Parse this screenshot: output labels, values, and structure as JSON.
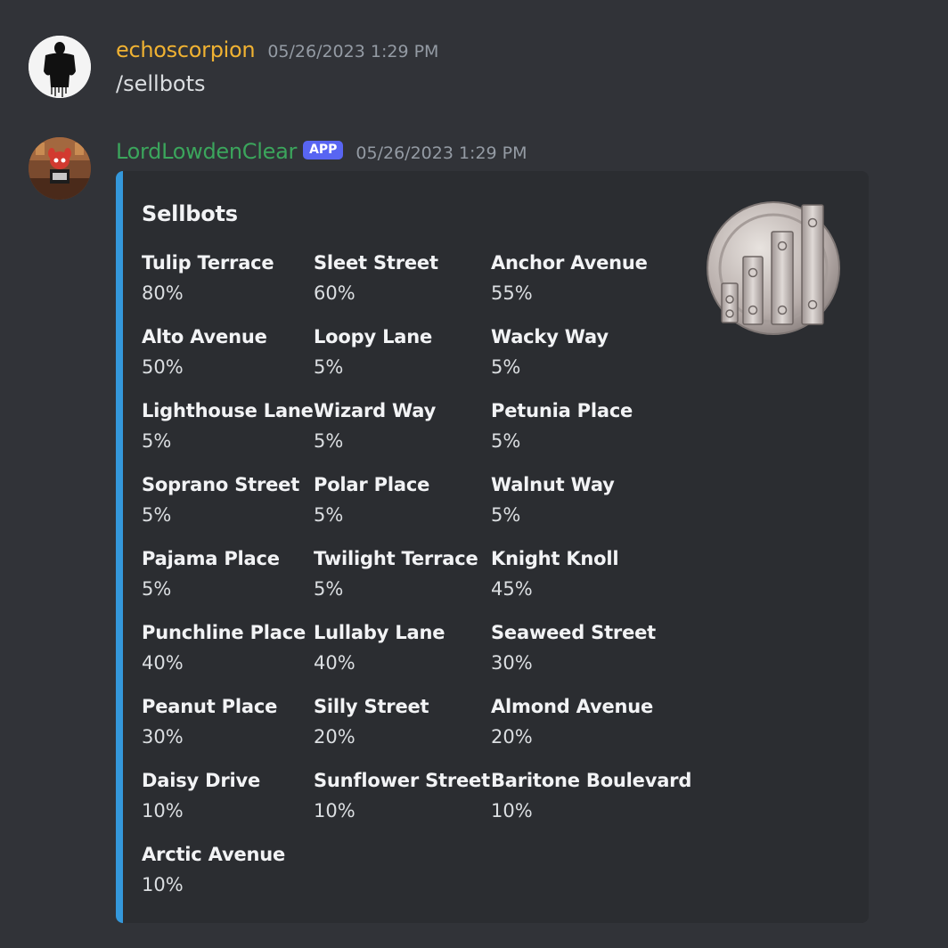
{
  "messages": [
    {
      "username": "echoscorpion",
      "username_color": "#f0b232",
      "timestamp": "05/26/2023 1:29 PM",
      "content": "/sellbots",
      "avatar_icon": "silhouette-avatar"
    },
    {
      "username": "LordLowdenClear",
      "username_color": "#3ba55c",
      "badge": "APP",
      "timestamp": "05/26/2023 1:29 PM",
      "avatar_icon": "toon-avatar"
    }
  ],
  "embed": {
    "accent_color": "#3498db",
    "title": "Sellbots",
    "thumbnail_icon": "sellbot-emblem",
    "fields": [
      {
        "name": "Tulip Terrace",
        "value": "80%"
      },
      {
        "name": "Sleet Street",
        "value": "60%"
      },
      {
        "name": "Anchor Avenue",
        "value": "55%"
      },
      {
        "name": "Alto Avenue",
        "value": "50%"
      },
      {
        "name": "Loopy Lane",
        "value": "5%"
      },
      {
        "name": "Wacky Way",
        "value": "5%"
      },
      {
        "name": "Lighthouse Lane",
        "value": "5%"
      },
      {
        "name": "Wizard Way",
        "value": "5%"
      },
      {
        "name": "Petunia Place",
        "value": "5%"
      },
      {
        "name": "Soprano Street",
        "value": "5%"
      },
      {
        "name": "Polar Place",
        "value": "5%"
      },
      {
        "name": "Walnut Way",
        "value": "5%"
      },
      {
        "name": "Pajama Place",
        "value": "5%"
      },
      {
        "name": "Twilight Terrace",
        "value": "5%"
      },
      {
        "name": "Knight Knoll",
        "value": "45%"
      },
      {
        "name": "Punchline Place",
        "value": "40%"
      },
      {
        "name": "Lullaby Lane",
        "value": "40%"
      },
      {
        "name": "Seaweed Street",
        "value": "30%"
      },
      {
        "name": "Peanut Place",
        "value": "30%"
      },
      {
        "name": "Silly Street",
        "value": "20%"
      },
      {
        "name": "Almond Avenue",
        "value": "20%"
      },
      {
        "name": "Daisy Drive",
        "value": "10%"
      },
      {
        "name": "Sunflower Street",
        "value": "10%"
      },
      {
        "name": "Baritone Boulevard",
        "value": "10%"
      },
      {
        "name": "Arctic Avenue",
        "value": "10%"
      }
    ]
  }
}
